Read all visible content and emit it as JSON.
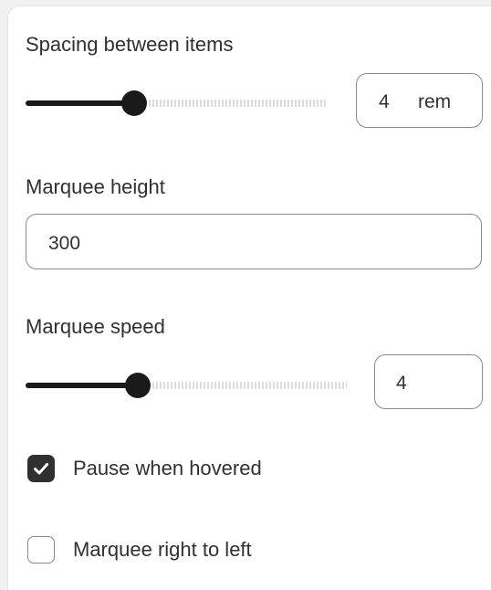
{
  "settings": {
    "spacing": {
      "label": "Spacing between items",
      "value": "4",
      "unit": "rem",
      "slider_fraction": 0.36
    },
    "height": {
      "label": "Marquee height",
      "value": "300"
    },
    "speed": {
      "label": "Marquee speed",
      "value": "4",
      "slider_fraction": 0.35
    },
    "pause_on_hover": {
      "label": "Pause when hovered",
      "checked": true
    },
    "right_to_left": {
      "label": "Marquee right to left",
      "checked": false
    }
  },
  "icons": {
    "checkmark": "checkmark-icon"
  }
}
